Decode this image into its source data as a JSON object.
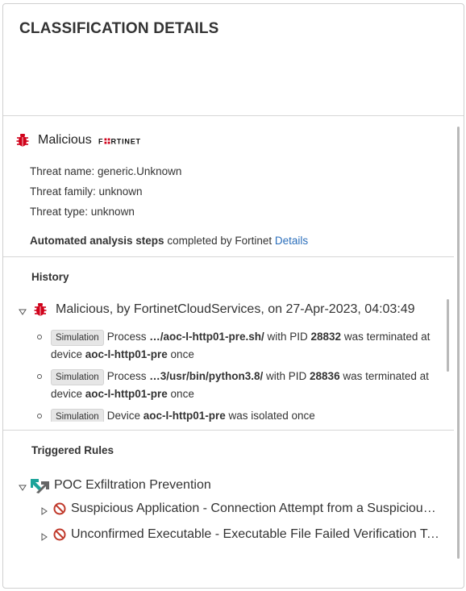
{
  "panel": {
    "title": "CLASSIFICATION DETAILS"
  },
  "verdict": {
    "label": "Malicious",
    "vendor_logo": {
      "text": "FORTINET",
      "icon": "fortinet-logo"
    },
    "icon": "bug-icon",
    "threat_name": "Threat name: generic.Unknown",
    "threat_family": "Threat family: unknown",
    "threat_type": "Threat type: unknown",
    "steps_bold": "Automated analysis steps",
    "steps_rest": " completed by Fortinet ",
    "details_link": "Details"
  },
  "history": {
    "heading": "History",
    "entry": {
      "icon": "bug-icon",
      "text": "Malicious, by FortinetCloudServices, on 27-Apr-2023, 04:03:49",
      "items": [
        {
          "tag": "Simulation",
          "p1": "Process ",
          "b1": "…/aoc-l-http01-pre.sh/",
          "p2": " with PID ",
          "b2": "28832",
          "p3": " was terminated at device ",
          "b3": "aoc-l-http01-pre",
          "p4": " once"
        },
        {
          "tag": "Simulation",
          "p1": "Process ",
          "b1": "…3/usr/bin/python3.8/",
          "p2": " with PID ",
          "b2": "28836",
          "p3": " was terminated at device ",
          "b3": "aoc-l-http01-pre",
          "p4": " once"
        },
        {
          "tag": "Simulation",
          "p1": "Device ",
          "b1": "aoc-l-http01-pre",
          "p2": " was isolated once",
          "b2": "",
          "p3": "",
          "b3": "",
          "p4": ""
        }
      ]
    }
  },
  "triggered_rules": {
    "heading": "Triggered Rules",
    "group": {
      "label": "POC Exfiltration Prevention",
      "icon": "exfiltration-icon",
      "rules": [
        {
          "label": "Suspicious Application - Connection Attempt from a Suspicious Application",
          "icon": "block-icon"
        },
        {
          "label": "Unconfirmed Executable - Executable File Failed Verification Test",
          "icon": "block-icon"
        }
      ]
    }
  },
  "colors": {
    "accent_link": "#2a6ebb",
    "malicious_red": "#d0021b",
    "block_red": "#c0392b",
    "exfil_teal": "#1aa39a"
  }
}
